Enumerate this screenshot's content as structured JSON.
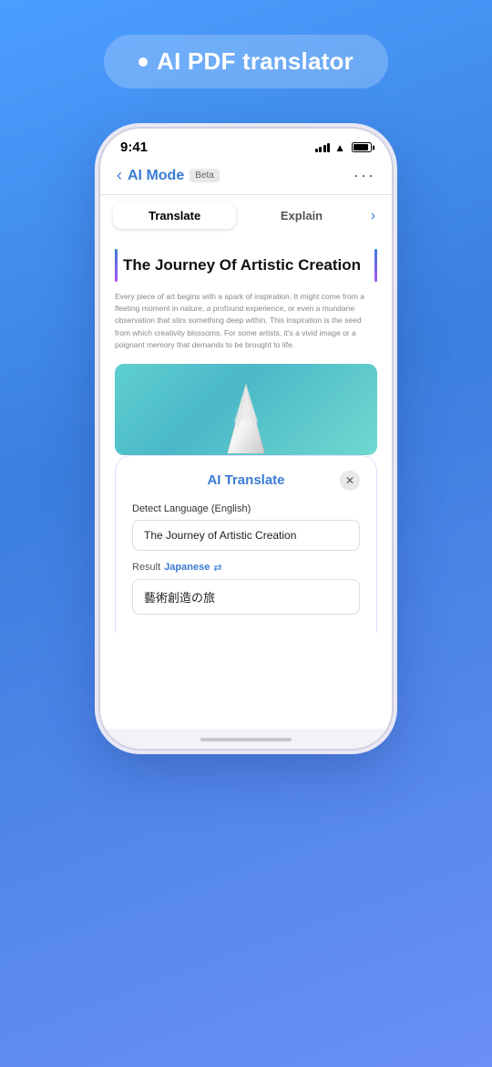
{
  "header": {
    "dot": "●",
    "title": "AI PDF translator"
  },
  "phone": {
    "status_bar": {
      "time": "9:41",
      "wifi": "wifi",
      "battery": "battery"
    },
    "nav": {
      "back_label": "‹",
      "title": "AI Mode",
      "badge": "Beta",
      "more": "···"
    },
    "tabs": {
      "tab1": "Translate",
      "tab2": "Explain",
      "arrow": "›"
    },
    "document": {
      "title": "The Journey Of Artistic Creation",
      "body": "Every piece of art begins with a spark of inspiration. It might come from a fleeting moment in nature, a profound experience, or even a mundane observation that stirs something deep within. This inspiration is the seed from which creativity blossoms. For some artists, it's a vivid image or a poignant memory that demands to be brought to life."
    },
    "translate_panel": {
      "title": "AI Translate",
      "close": "✕",
      "detect_label": "Detect Language",
      "detect_lang": "(English)",
      "source_text": "The Journey of Artistic Creation",
      "result_label": "Result",
      "result_lang": "Japanese",
      "swap_icon": "⇄",
      "result_text": "藝術創造の旅"
    },
    "home_bar": ""
  }
}
